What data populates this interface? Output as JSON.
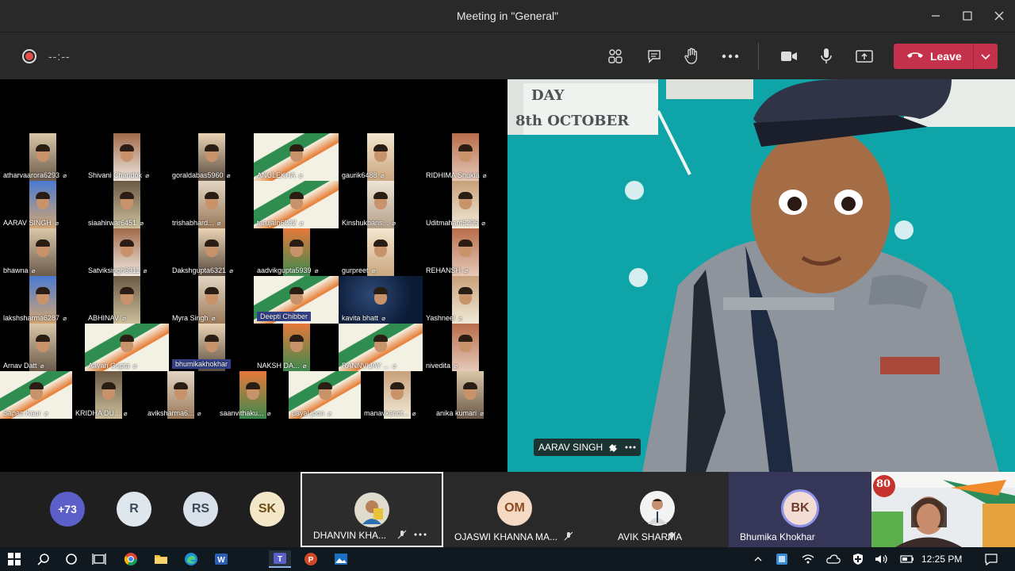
{
  "window": {
    "title": "Meeting in \"General\""
  },
  "toolbar": {
    "timer": "--:--",
    "leave_label": "Leave"
  },
  "gallery": [
    {
      "name": "atharvaarora6293"
    },
    {
      "name": "Shivani Chandok"
    },
    {
      "name": "goraldabas5960"
    },
    {
      "name": "ANULEKHA"
    },
    {
      "name": "gaurik6488"
    },
    {
      "name": "RIDHIMA Shukla"
    },
    {
      "name": "AARAV  SINGH"
    },
    {
      "name": "siaahirwar6451"
    },
    {
      "name": "trishabhard..."
    },
    {
      "name": "tarujain6232"
    },
    {
      "name": "Kinshukbans..."
    },
    {
      "name": "Uditmahant6296"
    },
    {
      "name": "bhawna"
    },
    {
      "name": "Satviksingh6311"
    },
    {
      "name": "Dakshgupta6321"
    },
    {
      "name": "aadvikgupta5939"
    },
    {
      "name": "gurpreet"
    },
    {
      "name": "REHANSH"
    },
    {
      "name": "lakshsharma6287"
    },
    {
      "name": "ABHINAV"
    },
    {
      "name": "Myra Singh"
    },
    {
      "name": "Deepti Chibber"
    },
    {
      "name": "kavita bhatt"
    },
    {
      "name": "Yashneel"
    },
    {
      "name": "Arnav Datt"
    },
    {
      "name": "Aayan Gupta"
    },
    {
      "name": "bhumikakhokhar"
    },
    {
      "name": "NAKSH DA..."
    },
    {
      "name": "RANNVIJAY ..."
    },
    {
      "name": "nivedita"
    },
    {
      "name": "Sapan Kaur"
    },
    {
      "name": "KRIDHA  DU..."
    },
    {
      "name": "aviksharma6..."
    },
    {
      "name": "saanvithaku..."
    },
    {
      "name": "payal joon"
    },
    {
      "name": "manavkanot..."
    },
    {
      "name": "anika kumari"
    }
  ],
  "spotlight": {
    "name": "AARAV SINGH",
    "poster_line1": "DAY",
    "poster_line2": "8th OCTOBER"
  },
  "strip": {
    "overflow": "+73",
    "avatars": [
      {
        "initials": "R"
      },
      {
        "initials": "RS"
      },
      {
        "initials": "SK"
      }
    ],
    "tiles": [
      {
        "name": "DHANVIN KHA..."
      },
      {
        "initials": "OM",
        "name": "OJASWI KHANNA MA..."
      },
      {
        "name": "AVIK SHARMA"
      },
      {
        "initials": "BK",
        "name": "Bhumika Khokhar"
      }
    ],
    "poster_badge": "80"
  },
  "taskbar": {
    "time": "12:25 PM"
  },
  "colors": {
    "leave": "#c4314b",
    "accent": "#5b5fc7"
  }
}
